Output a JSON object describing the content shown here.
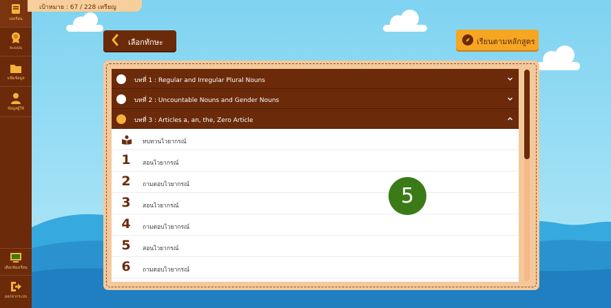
{
  "sidebar": {
    "items": [
      {
        "label": "บทเรียน",
        "icon": "book-icon"
      },
      {
        "label": "คะแนน",
        "icon": "medal-icon"
      },
      {
        "label": "แฟ้มข้อมูล",
        "icon": "folder-icon"
      },
      {
        "label": "ข้อมูลผู้ใช้",
        "icon": "user-icon"
      }
    ],
    "bottom": [
      {
        "label": "เลือกห้องเรียน",
        "icon": "classroom-icon"
      },
      {
        "label": "ออกจากระบบ",
        "icon": "logout-icon"
      }
    ]
  },
  "header": {
    "goal_text": "เป้าหมาย : 67 / 228 เหรียญ"
  },
  "buttons": {
    "back_label": "เลือกทักษะ",
    "curriculum_label": "เรียนตามหลักสูตร"
  },
  "chapters": [
    {
      "title": "บทที่ 1 : Regular and Irregular Plural Nouns",
      "expanded": false
    },
    {
      "title": "บทที่ 2 : Uncountable Nouns and Gender Nouns",
      "expanded": false
    },
    {
      "title": "บทที่ 3 : Articles a, an, the, Zero Article",
      "expanded": true
    }
  ],
  "lessons": [
    {
      "marker": "",
      "label": "ทบทวนไวยากรณ์"
    },
    {
      "marker": "1",
      "label": "สอนไวยากรณ์"
    },
    {
      "marker": "2",
      "label": "ถามตอบไวยากรณ์"
    },
    {
      "marker": "3",
      "label": "สอนไวยากรณ์"
    },
    {
      "marker": "4",
      "label": "ถามตอบไวยากรณ์"
    },
    {
      "marker": "5",
      "label": "สอนไวยากรณ์"
    },
    {
      "marker": "6",
      "label": "ถามตอบไวยากรณ์"
    }
  ],
  "badge": {
    "value": "5"
  },
  "colors": {
    "primary": "#6b2b0a",
    "accent": "#f6a623",
    "panel": "#f3c99c",
    "badge": "#3a7b18"
  }
}
